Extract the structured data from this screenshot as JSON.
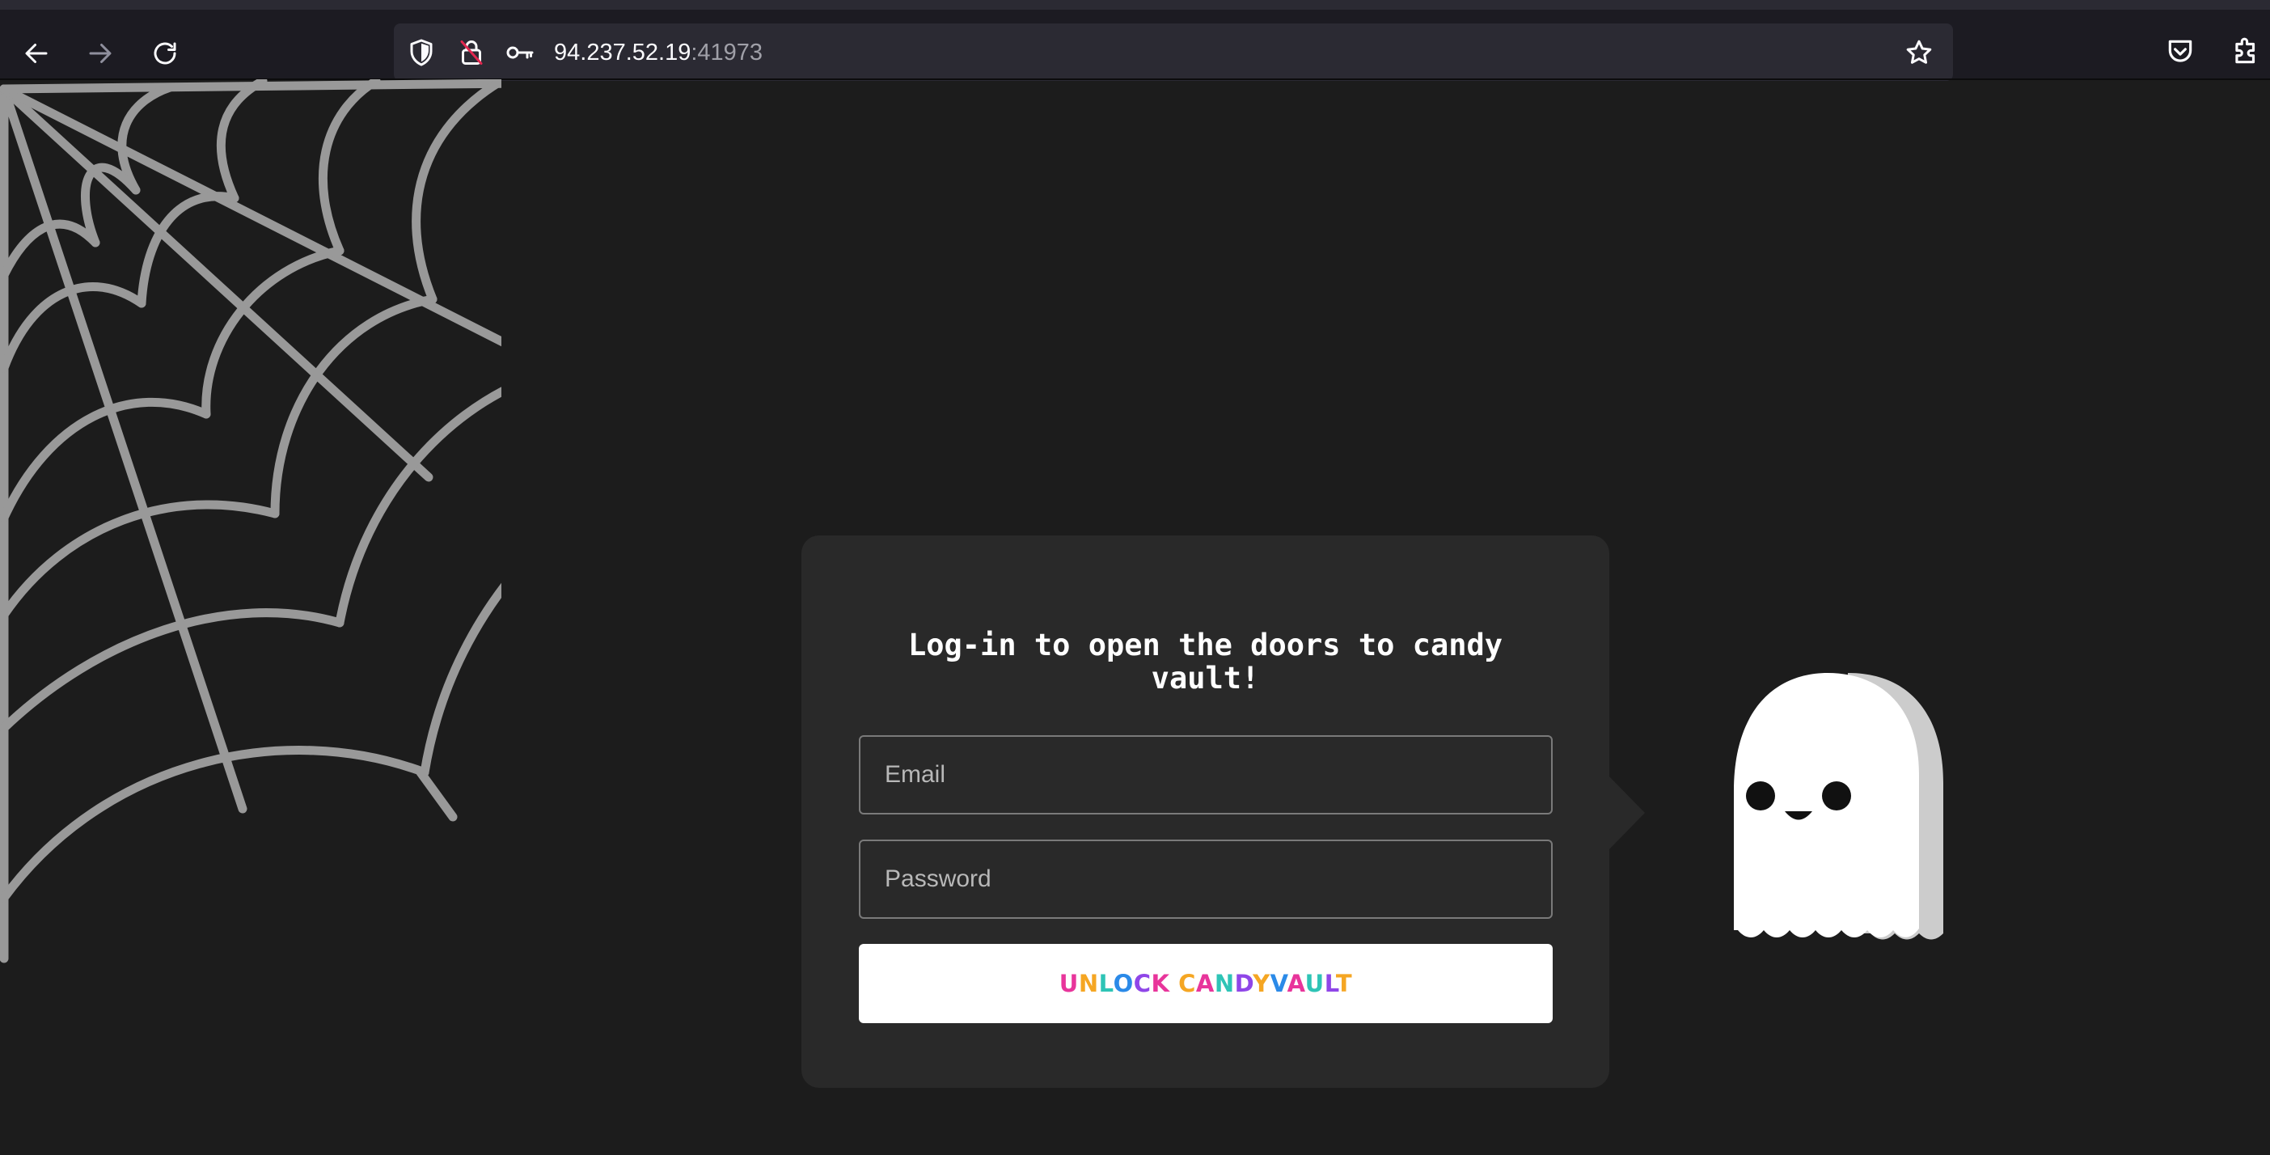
{
  "browser": {
    "url_host": "94.237.52.19",
    "url_port": ":41973",
    "icons": [
      "back-arrow-icon",
      "forward-arrow-icon",
      "reload-icon",
      "shield-icon",
      "insecure-lock-icon",
      "key-icon",
      "star-icon",
      "pocket-icon",
      "extensions-icon"
    ]
  },
  "login": {
    "title": "Log-in to open the doors to candy vault!",
    "email_placeholder": "Email",
    "password_placeholder": "Password",
    "submit_label": "UNLOCK CANDYVAULT",
    "submit_letter_colors": [
      "#e8359b",
      "#f5a623",
      "#2ec4b6",
      "#2b8ae8",
      "#8f46e8",
      "#e8359b",
      "#ffffff",
      "#f5a623",
      "#e8359b",
      "#2ec4b6",
      "#8f46e8",
      "#f5a623",
      "#2b8ae8",
      "#e8359b",
      "#2ec4b6",
      "#8f46e8",
      "#f5a623"
    ]
  },
  "colors": {
    "page_background": "#1c1c1c",
    "card_background": "#292929",
    "web_stroke": "#999999",
    "ghost_body": "#ffffff",
    "ghost_shadow": "#cccccc"
  }
}
